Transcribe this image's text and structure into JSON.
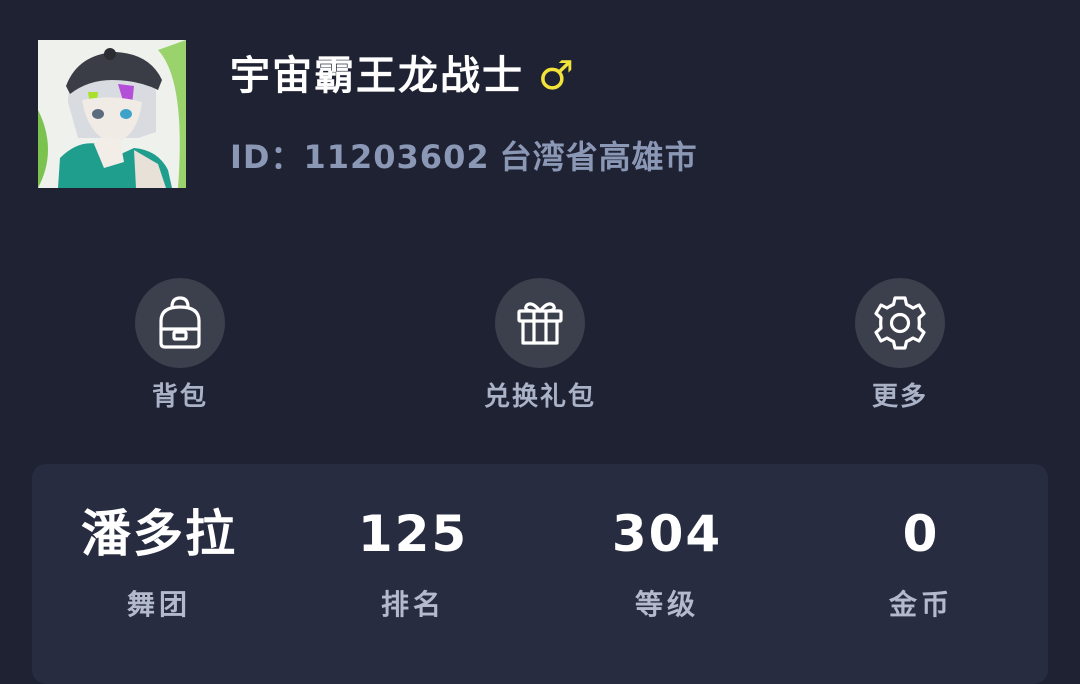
{
  "profile": {
    "username": "宇宙霸王龙战士",
    "gender_symbol": "♂",
    "id_label": "ID：11203602",
    "location": "台湾省高雄市",
    "avatar_icon": "anime-avatar",
    "colors": {
      "background": "#1f2233",
      "username": "#ffffff",
      "gender": "#f2e33a",
      "id_text": "#8b98b5"
    }
  },
  "actions": [
    {
      "label": "背包",
      "icon": "backpack-icon"
    },
    {
      "label": "兑换礼包",
      "icon": "gift-icon"
    },
    {
      "label": "更多",
      "icon": "gear-icon"
    }
  ],
  "stats": [
    {
      "value": "潘多拉",
      "label": "舞团"
    },
    {
      "value": "125",
      "label": "排名"
    },
    {
      "value": "304",
      "label": "等级"
    },
    {
      "value": "0",
      "label": "金币"
    }
  ]
}
